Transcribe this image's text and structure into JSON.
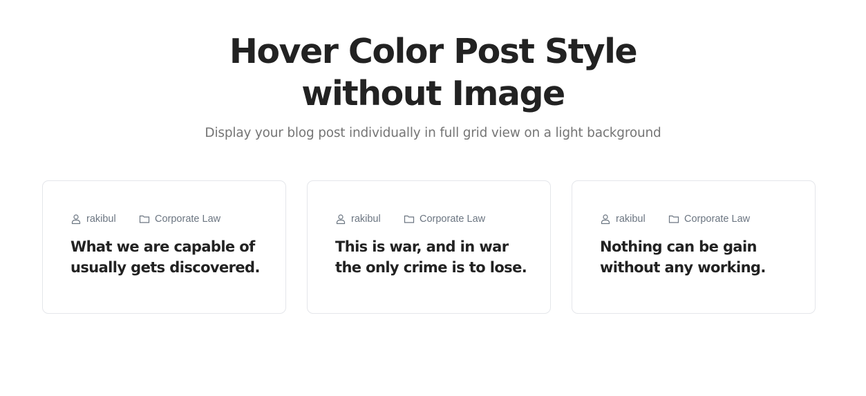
{
  "hero": {
    "title": "Hover Color Post Style without Image",
    "subtitle": "Display your blog post individually in full grid view on a light background"
  },
  "posts": [
    {
      "author": "rakibul",
      "author_icon": "user-icon",
      "category": "Corporate Law",
      "category_icon": "folder-icon",
      "title": "What we are capable of usually gets discovered."
    },
    {
      "author": "rakibul",
      "author_icon": "user-icon",
      "category": "Corporate Law",
      "category_icon": "folder-icon",
      "title": "This is war, and in war the only crime is to lose."
    },
    {
      "author": "rakibul",
      "author_icon": "user-icon",
      "category": "Corporate Law",
      "category_icon": "folder-icon",
      "title": "Nothing can be gain without any working."
    }
  ],
  "colors": {
    "heading": "#222222",
    "subtitle": "#757575",
    "meta": "#6b7581",
    "card_border": "#e4e6ea",
    "background": "#ffffff"
  }
}
